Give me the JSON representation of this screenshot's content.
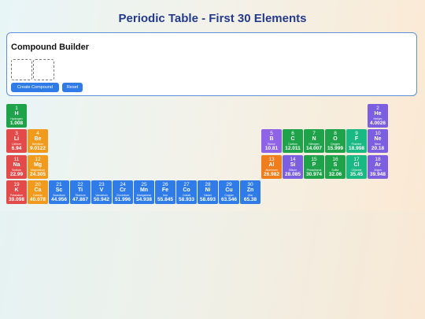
{
  "page_title": "Periodic Table - First 30 Elements",
  "builder": {
    "title": "Compound Builder",
    "create_label": "Create Compound",
    "reset_label": "Reset"
  },
  "colors": {
    "nonmetal": "#1fa34a",
    "noble-gas": "#7b5fe0",
    "alkali-metal": "#e34b4b",
    "alkaline-earth": "#f29a1b",
    "metalloid": "#7b5fe0",
    "halogen": "#1ab883",
    "post-transition": "#f07d1c",
    "transition-metal": "#2f7be8",
    "boron-group": "#8e63e6",
    "reactive-nonmetal": "#1fa34a"
  },
  "elements": [
    {
      "number": "1",
      "symbol": "H",
      "name": "Hydrogen",
      "mass": "1.008",
      "category": "nonmetal"
    },
    {
      "number": "2",
      "symbol": "He",
      "name": "Helium",
      "mass": "4.0026",
      "category": "noble-gas"
    },
    {
      "number": "3",
      "symbol": "Li",
      "name": "Lithium",
      "mass": "6.94",
      "category": "alkali-metal"
    },
    {
      "number": "4",
      "symbol": "Be",
      "name": "Beryllium",
      "mass": "9.0122",
      "category": "alkaline-earth"
    },
    {
      "number": "5",
      "symbol": "B",
      "name": "Boron",
      "mass": "10.81",
      "category": "boron-group"
    },
    {
      "number": "6",
      "symbol": "C",
      "name": "Carbon",
      "mass": "12.011",
      "category": "reactive-nonmetal"
    },
    {
      "number": "7",
      "symbol": "N",
      "name": "Nitrogen",
      "mass": "14.007",
      "category": "reactive-nonmetal"
    },
    {
      "number": "8",
      "symbol": "O",
      "name": "Oxygen",
      "mass": "15.999",
      "category": "reactive-nonmetal"
    },
    {
      "number": "9",
      "symbol": "F",
      "name": "Fluorine",
      "mass": "18.998",
      "category": "halogen"
    },
    {
      "number": "10",
      "symbol": "Ne",
      "name": "Neon",
      "mass": "20.18",
      "category": "noble-gas"
    },
    {
      "number": "11",
      "symbol": "Na",
      "name": "Sodium",
      "mass": "22.99",
      "category": "alkali-metal"
    },
    {
      "number": "12",
      "symbol": "Mg",
      "name": "Magnesium",
      "mass": "24.305",
      "category": "alkaline-earth"
    },
    {
      "number": "13",
      "symbol": "Al",
      "name": "Aluminum",
      "mass": "26.982",
      "category": "post-transition"
    },
    {
      "number": "14",
      "symbol": "Si",
      "name": "Silicon",
      "mass": "28.085",
      "category": "metalloid"
    },
    {
      "number": "15",
      "symbol": "P",
      "name": "Phosphorus",
      "mass": "30.974",
      "category": "reactive-nonmetal"
    },
    {
      "number": "16",
      "symbol": "S",
      "name": "Sulfur",
      "mass": "32.06",
      "category": "reactive-nonmetal"
    },
    {
      "number": "17",
      "symbol": "Cl",
      "name": "Chlorine",
      "mass": "35.45",
      "category": "halogen"
    },
    {
      "number": "18",
      "symbol": "Ar",
      "name": "Argon",
      "mass": "39.948",
      "category": "noble-gas"
    },
    {
      "number": "19",
      "symbol": "K",
      "name": "Potassium",
      "mass": "39.098",
      "category": "alkali-metal"
    },
    {
      "number": "20",
      "symbol": "Ca",
      "name": "Calcium",
      "mass": "40.078",
      "category": "alkaline-earth"
    },
    {
      "number": "21",
      "symbol": "Sc",
      "name": "Scandium",
      "mass": "44.956",
      "category": "transition-metal"
    },
    {
      "number": "22",
      "symbol": "Ti",
      "name": "Titanium",
      "mass": "47.867",
      "category": "transition-metal"
    },
    {
      "number": "23",
      "symbol": "V",
      "name": "Vanadium",
      "mass": "50.942",
      "category": "transition-metal"
    },
    {
      "number": "24",
      "symbol": "Cr",
      "name": "Chromium",
      "mass": "51.996",
      "category": "transition-metal"
    },
    {
      "number": "25",
      "symbol": "Mn",
      "name": "Manganese",
      "mass": "54.938",
      "category": "transition-metal"
    },
    {
      "number": "26",
      "symbol": "Fe",
      "name": "Iron",
      "mass": "55.845",
      "category": "transition-metal"
    },
    {
      "number": "27",
      "symbol": "Co",
      "name": "Cobalt",
      "mass": "58.933",
      "category": "transition-metal"
    },
    {
      "number": "28",
      "symbol": "Ni",
      "name": "Nickel",
      "mass": "58.693",
      "category": "transition-metal"
    },
    {
      "number": "29",
      "symbol": "Cu",
      "name": "Copper",
      "mass": "63.546",
      "category": "transition-metal"
    },
    {
      "number": "30",
      "symbol": "Zn",
      "name": "Zinc",
      "mass": "65.38",
      "category": "transition-metal"
    }
  ]
}
